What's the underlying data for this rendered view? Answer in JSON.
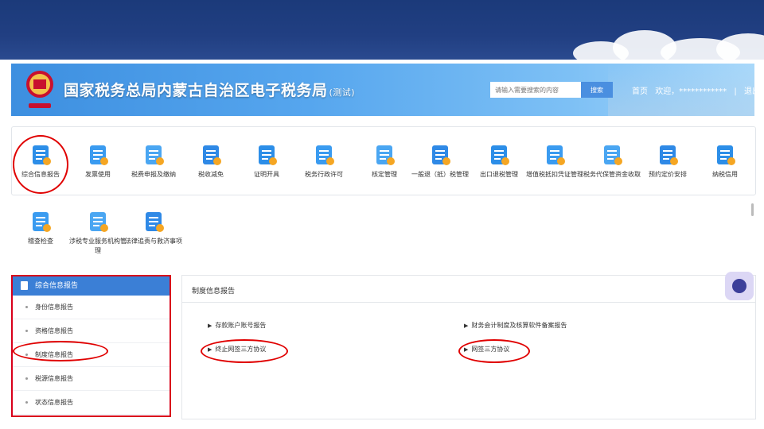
{
  "header": {
    "title": "国家税务总局内蒙古自治区电子税务局",
    "title_suffix": "(测试)",
    "search_placeholder": "请输入需要搜索的内容",
    "search_button": "搜索",
    "home_link": "首页",
    "welcome": "欢迎，************",
    "separator": "|",
    "logout": "退出"
  },
  "menu": [
    {
      "label": "综合信息报告",
      "icon": "report-clipboard-icon"
    },
    {
      "label": "发票使用",
      "icon": "invoice-icon"
    },
    {
      "label": "税费申报及缴纳",
      "icon": "tax-payment-icon"
    },
    {
      "label": "税收减免",
      "icon": "tax-relief-icon"
    },
    {
      "label": "证明开具",
      "icon": "certificate-icon"
    },
    {
      "label": "税务行政许可",
      "icon": "admin-license-icon"
    },
    {
      "label": "核定管理",
      "icon": "assessment-icon"
    },
    {
      "label": "一般退（抵）税管理",
      "icon": "tax-refund-icon"
    },
    {
      "label": "出口退税管理",
      "icon": "export-refund-icon"
    },
    {
      "label": "增值税抵扣凭证管理",
      "icon": "vat-voucher-icon"
    },
    {
      "label": "税务代保管资金收取",
      "icon": "custody-fund-icon"
    },
    {
      "label": "预约定价安排",
      "icon": "pricing-schedule-icon"
    },
    {
      "label": "纳税信用",
      "icon": "tax-credit-icon"
    },
    {
      "label": "稽查检查",
      "icon": "inspection-icon"
    },
    {
      "label": "涉税专业服务机构管理",
      "icon": "service-agency-icon"
    },
    {
      "label": "法律追责与救济事项",
      "icon": "legal-remedy-icon"
    }
  ],
  "sidebar": {
    "title": "综合信息报告",
    "items": [
      {
        "label": "身份信息报告"
      },
      {
        "label": "资格信息报告"
      },
      {
        "label": "制度信息报告"
      },
      {
        "label": "税源信息报告"
      },
      {
        "label": "状态信息报告"
      }
    ]
  },
  "content": {
    "title": "制度信息报告",
    "links": [
      {
        "label": "存款账户账号报告"
      },
      {
        "label": "财务会计制度及核算软件备案报告"
      },
      {
        "label": "终止网签三方协议"
      },
      {
        "label": "网签三方协议"
      }
    ]
  },
  "colors": {
    "header_blue": "#4a9be8",
    "sidebar_head": "#3b7fd6",
    "highlight_red": "#e00000",
    "slide_band": "#1f3d80"
  }
}
